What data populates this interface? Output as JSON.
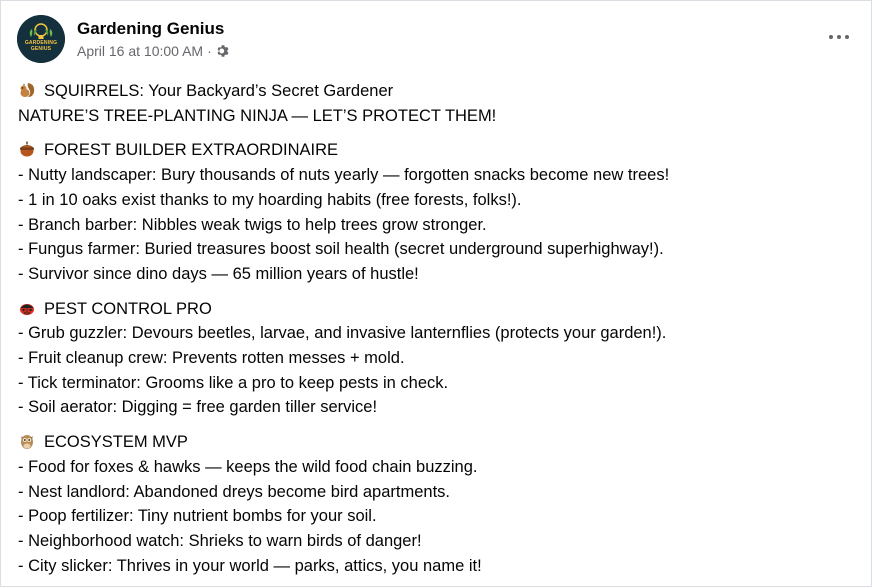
{
  "page": {
    "name": "Gardening Genius",
    "avatar_text": "GARDENING GENIUS",
    "timestamp": "April 16 at 10:00 AM",
    "separator": "·",
    "audience_icon": "gear-icon",
    "more_icon": "more-options-icon"
  },
  "post": {
    "intro": {
      "emoji": "squirrel-emoji",
      "title": "SQUIRRELS: Your Backyard’s Secret Gardener",
      "subtitle": "NATURE’S TREE-PLANTING NINJA — LET’S PROTECT THEM!"
    },
    "sections": [
      {
        "emoji": "acorn-emoji",
        "heading": "FOREST BUILDER EXTRAORDINAIRE",
        "items": [
          "- Nutty landscaper: Bury thousands of nuts yearly — forgotten snacks become new trees!",
          "- 1 in 10 oaks exist thanks to my hoarding habits (free forests, folks!).",
          "- Branch barber: Nibbles weak twigs to help trees grow stronger.",
          "- Fungus farmer: Buried treasures boost soil health (secret underground superhighway!).",
          "- Survivor since dino days — 65 million years of hustle!"
        ]
      },
      {
        "emoji": "ladybug-emoji",
        "heading": "PEST CONTROL PRO",
        "items": [
          "- Grub guzzler: Devours beetles, larvae, and invasive lanternflies (protects your garden!).",
          "- Fruit cleanup crew: Prevents rotten messes + mold.",
          "- Tick terminator: Grooms like a pro to keep pests in check.",
          "- Soil aerator: Digging = free garden tiller service!"
        ]
      },
      {
        "emoji": "owl-emoji",
        "heading": "ECOSYSTEM MVP",
        "items": [
          "- Food for foxes & hawks — keeps the wild food chain buzzing.",
          "- Nest landlord: Abandoned dreys become bird apartments.",
          "- Poop fertilizer: Tiny nutrient bombs for your soil.",
          "- Neighborhood watch: Shrieks to warn birds of danger!",
          "- City slicker: Thrives in your world — parks, attics, you name it!"
        ]
      }
    ]
  },
  "colors": {
    "text": "#050505",
    "meta": "#65676b",
    "border": "#dadde1",
    "avatar_bg": "#15303d",
    "avatar_accent": "#f5c542"
  }
}
